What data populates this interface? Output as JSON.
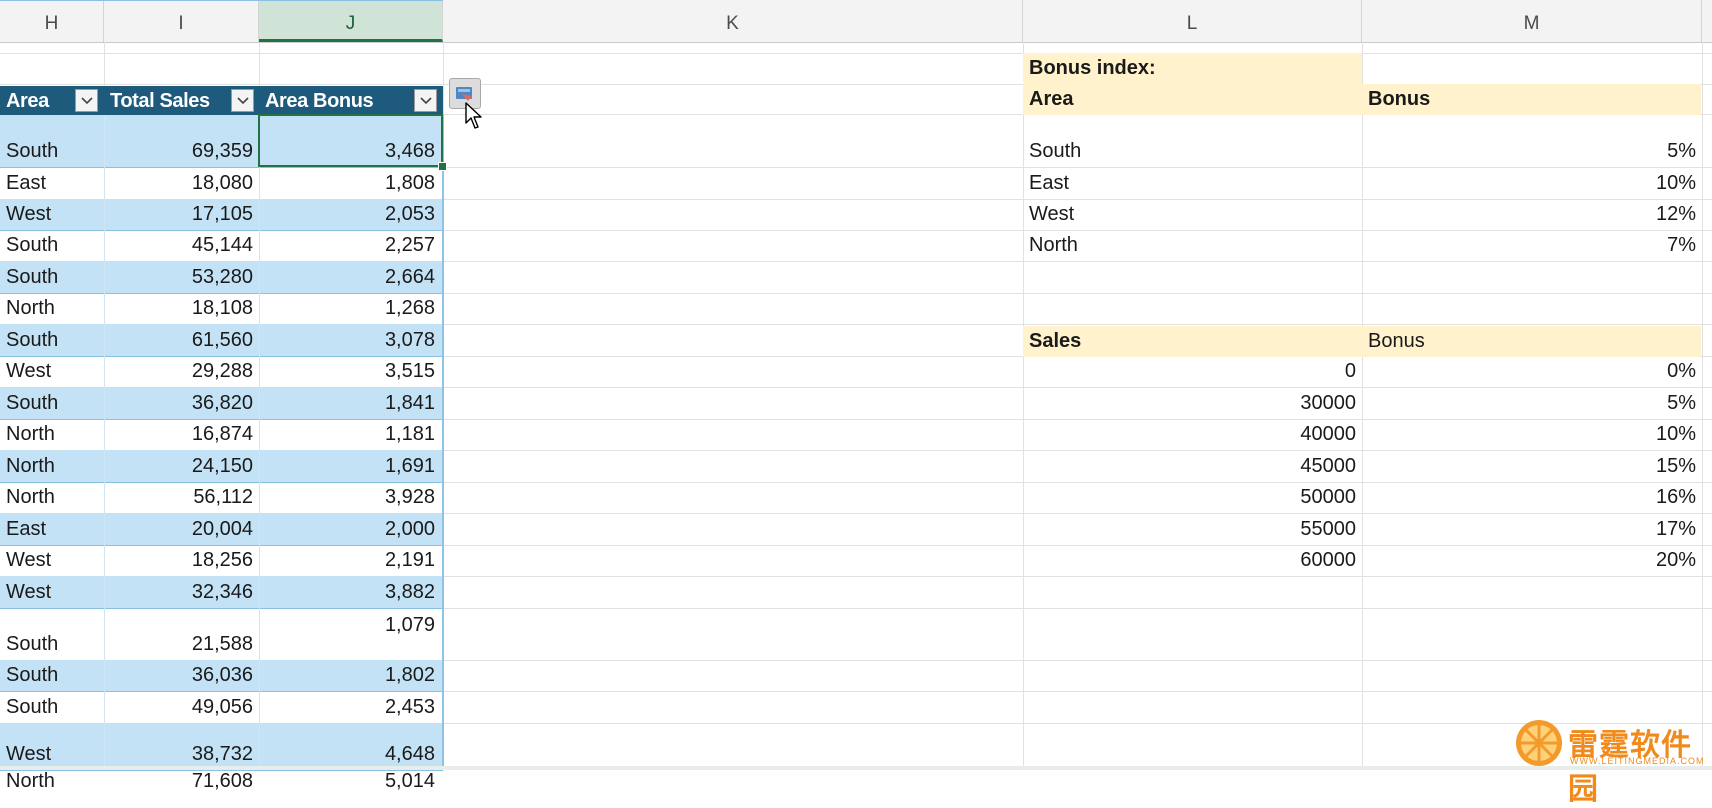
{
  "columns": {
    "h": "H",
    "i": "I",
    "j": "J",
    "k": "K",
    "l": "L",
    "m": "M"
  },
  "table": {
    "headers": [
      "Area",
      "Total Sales",
      "Area Bonus"
    ],
    "rows": [
      {
        "area": "South",
        "sales": "69,359",
        "bonus": "3,468"
      },
      {
        "area": "East",
        "sales": "18,080",
        "bonus": "1,808"
      },
      {
        "area": "West",
        "sales": "17,105",
        "bonus": "2,053"
      },
      {
        "area": "South",
        "sales": "45,144",
        "bonus": "2,257"
      },
      {
        "area": "South",
        "sales": "53,280",
        "bonus": "2,664"
      },
      {
        "area": "North",
        "sales": "18,108",
        "bonus": "1,268"
      },
      {
        "area": "South",
        "sales": "61,560",
        "bonus": "3,078"
      },
      {
        "area": "West",
        "sales": "29,288",
        "bonus": "3,515"
      },
      {
        "area": "South",
        "sales": "36,820",
        "bonus": "1,841"
      },
      {
        "area": "North",
        "sales": "16,874",
        "bonus": "1,181"
      },
      {
        "area": "North",
        "sales": "24,150",
        "bonus": "1,691"
      },
      {
        "area": "North",
        "sales": "56,112",
        "bonus": "3,928"
      },
      {
        "area": "East",
        "sales": "20,004",
        "bonus": "2,000"
      },
      {
        "area": "West",
        "sales": "18,256",
        "bonus": "2,191"
      },
      {
        "area": "West",
        "sales": "32,346",
        "bonus": "3,882"
      },
      {
        "area": "South",
        "sales": "21,588",
        "bonus": "1,079"
      },
      {
        "area": "South",
        "sales": "36,036",
        "bonus": "1,802"
      },
      {
        "area": "South",
        "sales": "49,056",
        "bonus": "2,453"
      },
      {
        "area": "West",
        "sales": "38,732",
        "bonus": "4,648"
      },
      {
        "area": "North",
        "sales": "71,608",
        "bonus": "5,014"
      }
    ]
  },
  "bonus_index": {
    "title": "Bonus index:",
    "headers": [
      "Area",
      "Bonus"
    ],
    "rows": [
      {
        "area": "South",
        "bonus": "5%"
      },
      {
        "area": "East",
        "bonus": "10%"
      },
      {
        "area": "West",
        "bonus": "12%"
      },
      {
        "area": "North",
        "bonus": "7%"
      }
    ]
  },
  "sales_tiers": {
    "headers": [
      "Sales",
      "Bonus"
    ],
    "rows": [
      {
        "sales": "0",
        "bonus": "0%"
      },
      {
        "sales": "30000",
        "bonus": "5%"
      },
      {
        "sales": "40000",
        "bonus": "10%"
      },
      {
        "sales": "45000",
        "bonus": "15%"
      },
      {
        "sales": "50000",
        "bonus": "16%"
      },
      {
        "sales": "55000",
        "bonus": "17%"
      },
      {
        "sales": "60000",
        "bonus": "20%"
      }
    ]
  },
  "watermark": {
    "name": "雷霆软件园",
    "url": "WWW.LEITINGMEDIA.COM"
  },
  "colors": {
    "table_header": "#1e5a7c",
    "table_band": "#c3e2f5",
    "highlight": "#fff2cc",
    "selection": "#217346"
  },
  "icons": {
    "quick_analysis": "quick-analysis-icon",
    "filter": "filter-dropdown-icon",
    "cursor": "mouse-pointer-icon"
  }
}
